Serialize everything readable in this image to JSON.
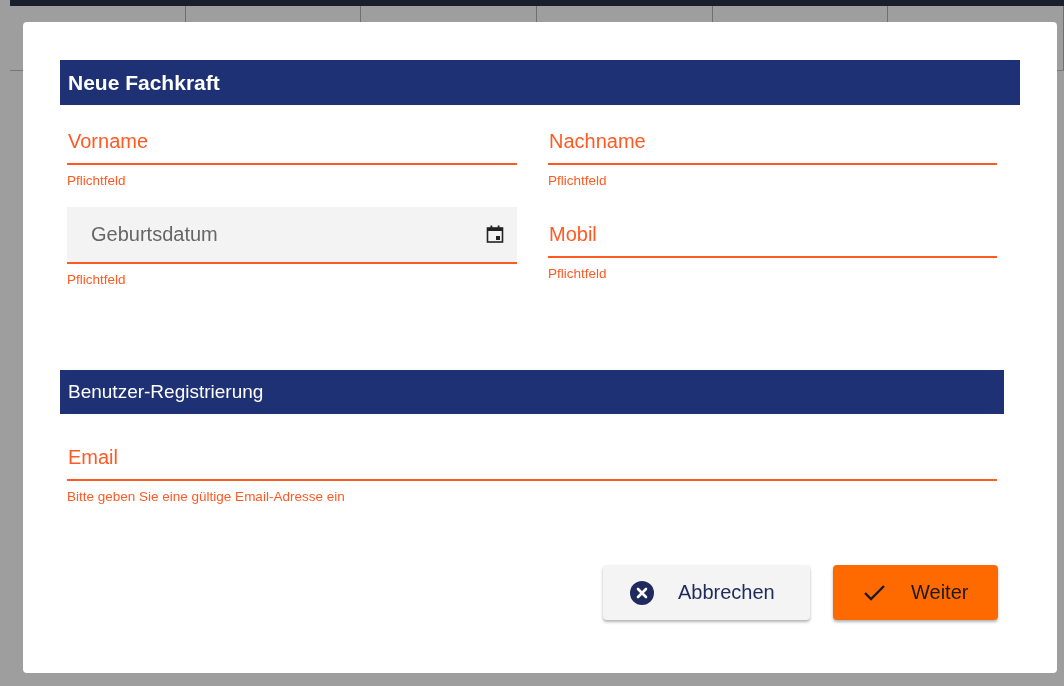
{
  "dialog": {
    "title": "Neue Fachkraft",
    "left_fields": [
      {
        "kind": "line",
        "placeholder": "Vorname",
        "hint": "Pflichtfeld",
        "invalid": true
      },
      {
        "kind": "filled",
        "placeholder": "Geburtsdatum",
        "hint": "Pflichtfeld",
        "invalid": true
      }
    ],
    "right_fields": [
      {
        "kind": "line",
        "placeholder": "Nachname",
        "hint": "Pflichtfeld",
        "invalid": true
      },
      {
        "kind": "line",
        "placeholder": "Mobil",
        "hint": "Pflichtfeld",
        "invalid": true
      }
    ],
    "section": {
      "title": "Benutzer-Registrierung"
    },
    "email_field": {
      "kind": "line",
      "placeholder": "Email",
      "hint": "Bitte geben Sie eine gültige Email-Adresse ein",
      "invalid": true
    },
    "buttons": [
      {
        "label": "Abbrechen",
        "kind": "secondary"
      },
      {
        "label": "Weiter",
        "kind": "primary"
      }
    ]
  }
}
